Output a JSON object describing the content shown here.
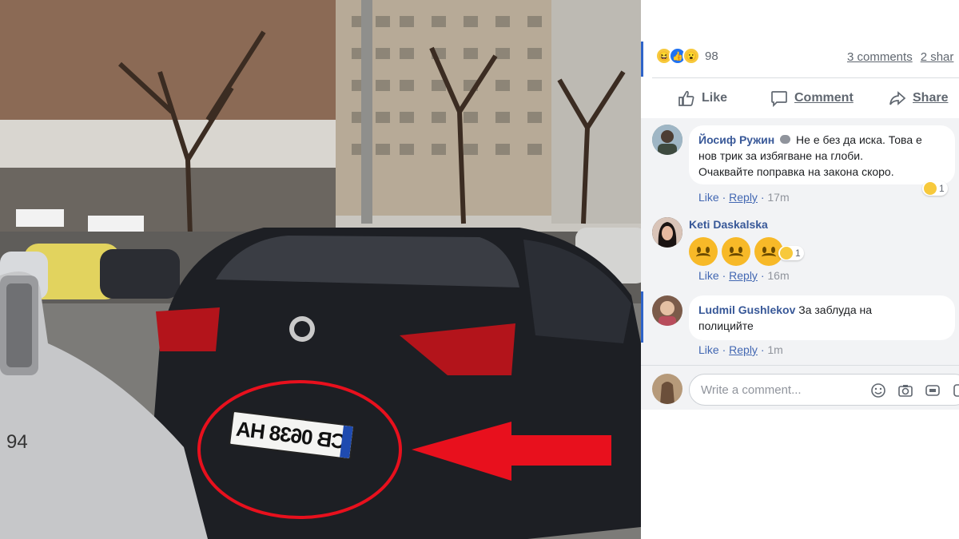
{
  "photo": {
    "plate_text": "CB 0638 HA",
    "left_car_number": "94",
    "colors": {
      "annotation": "#e8101d",
      "car": "#1d1f24"
    }
  },
  "post": {
    "reaction_count": "98",
    "comments_link": "3 comments",
    "shares_link": "2 shar",
    "actions": {
      "like": "Like",
      "comment": "Comment",
      "share": "Share"
    }
  },
  "comments": [
    {
      "author": "Йосиф Ружин",
      "text_line1": "Не е без да иска. Това е",
      "text_line2": "нов трик за избягване на глоби.",
      "text_line3": "Очаквайте поправка на закона скоро.",
      "like": "Like",
      "reply": "Reply",
      "time": "17m",
      "reaction_count": "1"
    },
    {
      "author": "Keti Daskalska",
      "like": "Like",
      "reply": "Reply",
      "time": "16m",
      "reaction_count": "1"
    },
    {
      "author": "Ludmil Gushlekov",
      "text_line1": "За заблуда на",
      "text_line2": "полицийте",
      "like": "Like",
      "reply": "Reply",
      "time": "1m"
    }
  ],
  "composer": {
    "placeholder": "Write a comment..."
  },
  "icons": [
    "like-icon",
    "comment-icon",
    "share-icon",
    "emoji-icon",
    "camera-icon",
    "gif-icon",
    "sticker-icon"
  ],
  "accent": "#385898"
}
